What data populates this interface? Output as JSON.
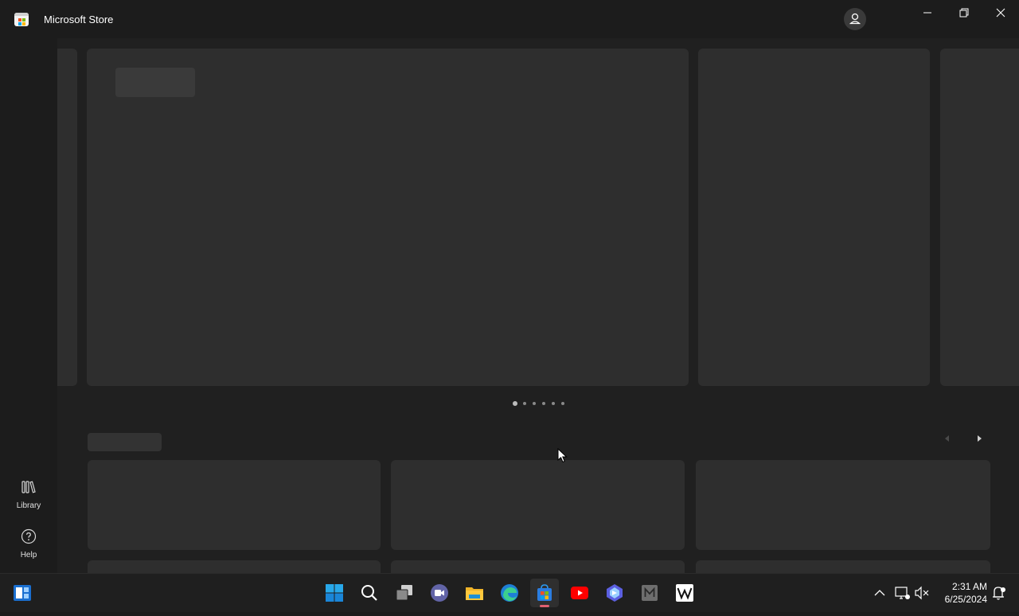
{
  "window": {
    "title": "Microsoft Store",
    "icons": {
      "app": "store-icon",
      "account": "person-icon",
      "minimize": "minimize-icon",
      "restore": "restore-icon",
      "close": "close-icon"
    }
  },
  "sidebar": {
    "items": [
      {
        "label": "Library",
        "icon": "library-icon"
      },
      {
        "label": "Help",
        "icon": "help-icon"
      }
    ]
  },
  "carousel": {
    "page_count": 6,
    "active_page": 1
  },
  "taskbar": {
    "apps": [
      "start",
      "search",
      "task-view",
      "teams-meet",
      "file-explorer",
      "edge",
      "microsoft-store",
      "youtube",
      "copilot",
      "m-app",
      "wikipedia"
    ],
    "active_app": "microsoft-store",
    "clock": {
      "time": "2:31 AM",
      "date": "6/25/2024"
    }
  },
  "colors": {
    "background": "#202020",
    "tile": "#2e2e2e",
    "skeleton": "#3a3a3a",
    "windows_blue": "#0078d4"
  }
}
